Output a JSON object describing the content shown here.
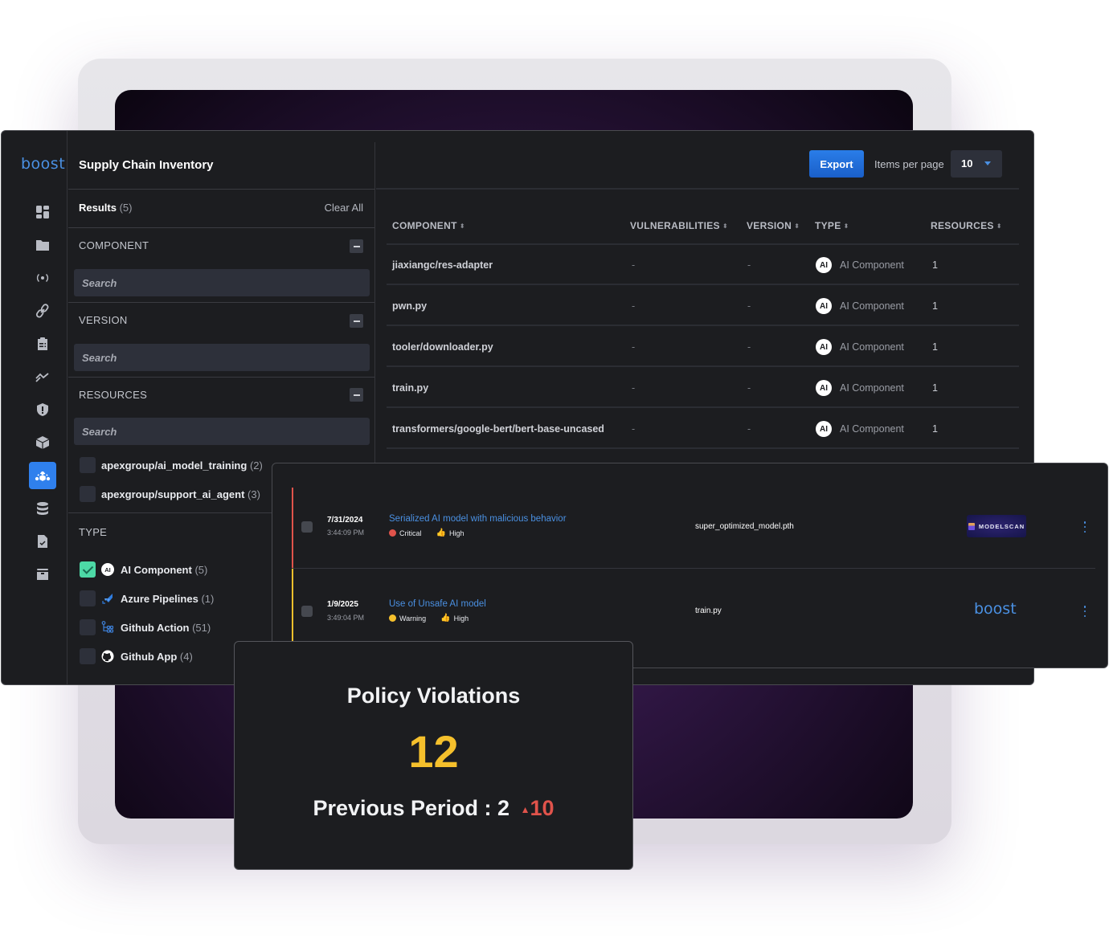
{
  "app": {
    "logo": "boost",
    "page_title": "Supply Chain Inventory"
  },
  "rail": {
    "icons": [
      "dashboard-icon",
      "folder-icon",
      "broadcast-icon",
      "link-icon",
      "clipboard-icon",
      "trend-icon",
      "shield-alert-icon",
      "package-icon",
      "ai-supply-chain-icon",
      "database-icon",
      "file-check-icon",
      "archive-icon"
    ],
    "active": "ai-supply-chain-icon"
  },
  "filters": {
    "results_label": "Results",
    "results_count": "(5)",
    "clear_all": "Clear All",
    "component": {
      "label": "COMPONENT",
      "placeholder": "Search"
    },
    "version": {
      "label": "VERSION",
      "placeholder": "Search"
    },
    "resources": {
      "label": "RESOURCES",
      "placeholder": "Search",
      "items": [
        {
          "name": "apexgroup/ai_model_training",
          "count": "(2)",
          "checked": false
        },
        {
          "name": "apexgroup/support_ai_agent",
          "count": "(3)",
          "checked": false
        }
      ]
    },
    "type": {
      "label": "TYPE",
      "items": [
        {
          "name": "AI Component",
          "count": "(5)",
          "checked": true,
          "icon": "ai-icon"
        },
        {
          "name": "Azure Pipelines",
          "count": "(1)",
          "checked": false,
          "icon": "azure-pipelines-icon"
        },
        {
          "name": "Github Action",
          "count": "(51)",
          "checked": false,
          "icon": "github-action-icon"
        },
        {
          "name": "Github App",
          "count": "(4)",
          "checked": false,
          "icon": "github-icon"
        }
      ]
    }
  },
  "toolbar": {
    "export_label": "Export",
    "items_per_page_label": "Items per page",
    "items_per_page_value": "10"
  },
  "table": {
    "columns": [
      "COMPONENT",
      "VULNERABILITIES",
      "VERSION",
      "TYPE",
      "RESOURCES"
    ],
    "sort_glyph": "⬍",
    "rows": [
      {
        "component": "jiaxiangc/res-adapter",
        "vulnerabilities": "-",
        "version": "-",
        "type_badge": "AI",
        "type": "AI Component",
        "resources": "1"
      },
      {
        "component": "pwn.py",
        "vulnerabilities": "-",
        "version": "-",
        "type_badge": "AI",
        "type": "AI Component",
        "resources": "1"
      },
      {
        "component": "tooler/downloader.py",
        "vulnerabilities": "-",
        "version": "-",
        "type_badge": "AI",
        "type": "AI Component",
        "resources": "1"
      },
      {
        "component": "train.py",
        "vulnerabilities": "-",
        "version": "-",
        "type_badge": "AI",
        "type": "AI Component",
        "resources": "1"
      },
      {
        "component": "transformers/google-bert/bert-base-uncased",
        "vulnerabilities": "-",
        "version": "-",
        "type_badge": "AI",
        "type": "AI Component",
        "resources": "1"
      }
    ]
  },
  "findings": [
    {
      "date": "7/31/2024",
      "time": "3:44:09 PM",
      "title": "Serialized AI model with malicious behavior",
      "severity": "Critical",
      "severity_color": "#e0534b",
      "confidence": "High",
      "file": "super_optimized_model.pth",
      "source": "MODELSCAN"
    },
    {
      "date": "1/9/2025",
      "time": "3:49:04 PM",
      "title": "Use of Unsafe AI model",
      "severity": "Warning",
      "severity_color": "#f5c02c",
      "confidence": "High",
      "file": "train.py",
      "source": "boost"
    }
  ],
  "policy": {
    "title": "Policy Violations",
    "value": "12",
    "previous_label": "Previous Period : 2",
    "delta_glyph": "▲",
    "delta": "10"
  },
  "colors": {
    "accent": "#2f80ed",
    "brand_blue": "#4a90e2",
    "checked_green": "#4dd9a6",
    "critical": "#e0534b",
    "warning": "#f5c02c"
  }
}
